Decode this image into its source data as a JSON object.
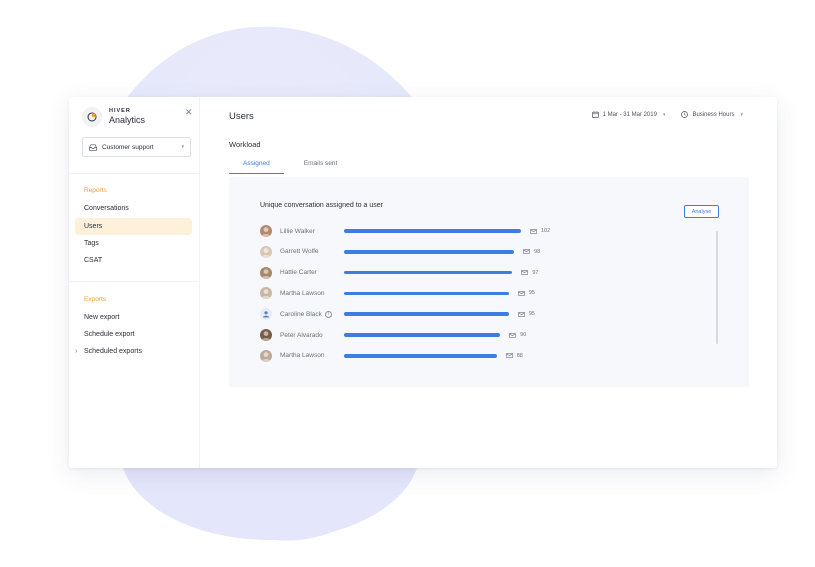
{
  "sidebar": {
    "brand_top": "HIVER",
    "brand_name": "Analytics",
    "workspace": "Customer support",
    "reports_title": "Reports",
    "reports": [
      "Conversations",
      "Users",
      "Tags",
      "CSAT"
    ],
    "active_item": "Users",
    "exports_title": "Exports",
    "exports": [
      "New export",
      "Schedule export",
      "Scheduled exports"
    ]
  },
  "header": {
    "title": "Users",
    "date_range": "1 Mar - 31 Mar 2019",
    "hours": "Business Hours"
  },
  "workload": {
    "title": "Workload",
    "tabs": [
      "Assigned",
      "Emails sent"
    ],
    "active_tab": "Assigned",
    "panel_title": "Unique conversation assigned to a user",
    "analyse_label": "Analyse"
  },
  "colors": {
    "accent": "#3b7de0",
    "reports_heading": "#e8a23a",
    "active_bg": "#fdf1dc"
  },
  "chart_data": {
    "type": "bar",
    "title": "Unique conversation assigned to a user",
    "categories": [
      "Lillie Walker",
      "Garrett Wolfe",
      "Hattie Carter",
      "Martha Lawson",
      "Caroline Black",
      "Peter Alvarado",
      "Martha Lawson"
    ],
    "values": [
      102,
      98,
      97,
      95,
      95,
      90,
      88
    ],
    "value_labels": [
      "102",
      "98",
      "97",
      "95",
      "95",
      "90",
      "88"
    ],
    "orientation": "horizontal"
  }
}
